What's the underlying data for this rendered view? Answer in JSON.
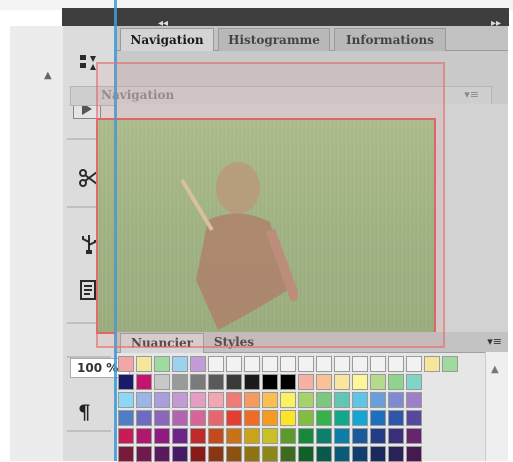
{
  "tabs": [
    {
      "label": "Navigation",
      "active": true
    },
    {
      "label": "Histogramme",
      "active": false
    },
    {
      "label": "Informations",
      "active": false
    }
  ],
  "subheader": {
    "label": "Navigation",
    "menu_icon": "panel-menu-icon"
  },
  "collapse": {
    "left": "◂◂",
    "right": "▸▸"
  },
  "swatches_panel": {
    "tabs": [
      {
        "label": "Nuancier",
        "active": true
      },
      {
        "label": "Styles",
        "active": false
      }
    ],
    "zoom_value": "100 %",
    "menu_glyph": "▾≡"
  },
  "tools": [
    {
      "name": "tool-icon",
      "glyph": "⚎"
    },
    {
      "name": "play-icon",
      "glyph": "▶"
    },
    {
      "name": "scissors-icon",
      "glyph": "✂"
    },
    {
      "name": "usb-icon",
      "glyph": "⚲"
    },
    {
      "name": "document-icon",
      "glyph": "▤"
    }
  ],
  "paragraph_tool": "¶",
  "colors": {
    "guide": "#3f9ad6",
    "accent_border": "#e06464",
    "preview": "#98bb84",
    "swatch_row1": [
      "#f4a6a6",
      "#f6e59a",
      "#9edb9e",
      "#9cd1ef",
      "#c29cd7",
      "#f2f2f2",
      "#f2f2f2",
      "#f2f2f2",
      "#f2f2f2",
      "#f2f2f2",
      "#f2f2f2",
      "#f2f2f2",
      "#f2f2f2",
      "#f2f2f2",
      "#f2f2f2",
      "#f2f2f2",
      "#f2f2f2",
      "#f6e59a",
      "#9edb9e"
    ],
    "swatch_row2": [
      "#1a1a6a",
      "#c4146c",
      "#c8c8c8",
      "#9a9a9a",
      "#7a7a7a",
      "#5a5a5a",
      "#3a3a3a",
      "#1a1a1a",
      "#000000",
      "#000000",
      "#f6b0a4",
      "#f8c296",
      "#f8e6a0",
      "#fff599",
      "#b7d98a",
      "#8fd48c",
      "#7fd6c6"
    ],
    "swatch_row3": [
      "#8ed6f5",
      "#9bb6e6",
      "#a8a0dd",
      "#c49ad6",
      "#e59dc3",
      "#f3a7b4",
      "#f07a74",
      "#f59b62",
      "#fcbf4f",
      "#fbf263",
      "#a6d26a",
      "#7dc881",
      "#61c7b5",
      "#5fc5e6",
      "#6a9fd9",
      "#7f8bd0",
      "#9c7ec9"
    ],
    "swatch_row4": [
      "#4f7ec7",
      "#6c6cc2",
      "#8a66bd",
      "#b364b0",
      "#d96497",
      "#e6666d",
      "#e63d31",
      "#ef6c22",
      "#f69b1f",
      "#fde526",
      "#82bd41",
      "#35b24a",
      "#12a88d",
      "#16a6d6",
      "#1f6fbf",
      "#2f56aa",
      "#57489e"
    ],
    "swatch_row5": [
      "#c91c57",
      "#b1176f",
      "#8e1a82",
      "#6c2489",
      "#c22a2a",
      "#c24a1c",
      "#c77316",
      "#c9a318",
      "#c8c024",
      "#5c9a2c",
      "#168a3a",
      "#0d7f6b",
      "#0b7fa7",
      "#1a5a9a",
      "#243c86",
      "#3a2f7a",
      "#66256f"
    ],
    "swatch_row6": [
      "#7a1a3a",
      "#6f1a4d",
      "#5c1a5e",
      "#461a66",
      "#8a1a1a",
      "#8a3612",
      "#8c5310",
      "#8d7312",
      "#8b881a",
      "#3f6b1f",
      "#0f6127",
      "#0a5a4b",
      "#0a5b77",
      "#123f6d",
      "#1a2a5f",
      "#2a2257",
      "#471a4f"
    ]
  }
}
